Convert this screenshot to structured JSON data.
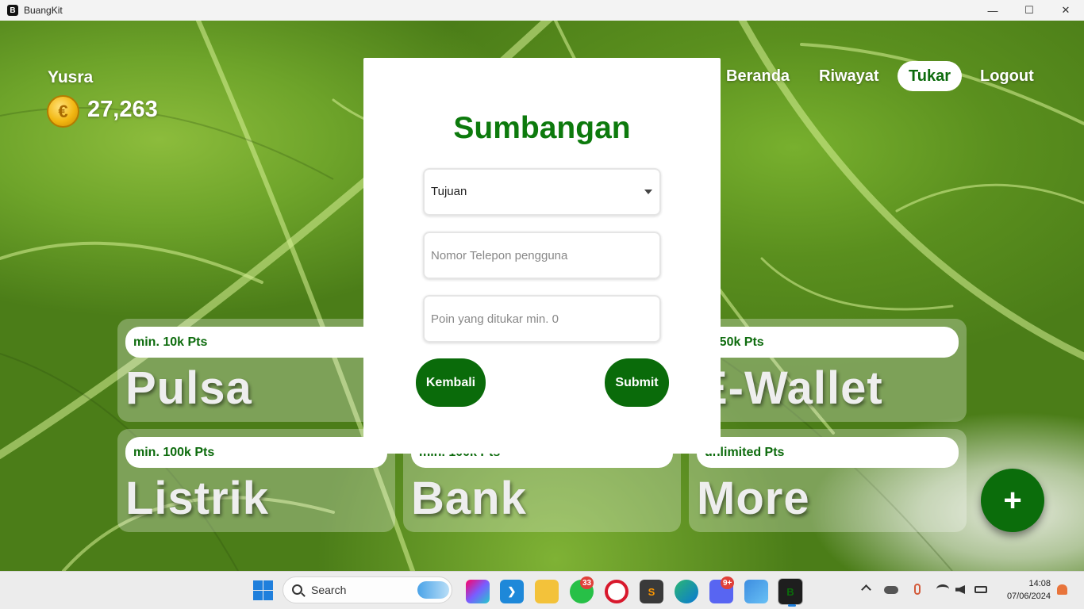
{
  "window": {
    "title": "BuangKit",
    "app_icon_letter": "B"
  },
  "user": {
    "name": "Yusra",
    "points": "27,263",
    "coin_symbol": "€"
  },
  "nav": {
    "items": [
      "Beranda",
      "Riwayat",
      "Tukar",
      "Logout"
    ],
    "active": "Tukar"
  },
  "cards": [
    {
      "min": "min. 10k Pts",
      "title": "Pulsa"
    },
    {
      "min": "n. 50k Pts",
      "title": "E-Wallet"
    },
    {
      "min": "min. 100k Pts",
      "title": "Listrik"
    },
    {
      "min": "min. 100k Pts",
      "title": "Bank"
    },
    {
      "min": "unlimited Pts",
      "title": "More"
    }
  ],
  "modal": {
    "title": "Sumbangan",
    "select_value": "Tujuan",
    "phone_placeholder": "Nomor Telepon pengguna",
    "points_placeholder": "Poin yang ditukar min. 0",
    "back_label": "Kembali",
    "submit_label": "Submit"
  },
  "fab": {
    "symbol": "+"
  },
  "taskbar": {
    "search_placeholder": "Search",
    "whatsapp_badge": "33",
    "discord_badge": "9+",
    "clock_time": "14:08",
    "clock_date": "07/06/2024"
  },
  "colors": {
    "accent": "#0a6b0a",
    "card_text": "#eeeeee",
    "badge": "#e0403a"
  }
}
